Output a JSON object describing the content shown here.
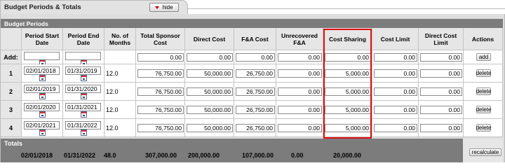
{
  "section": {
    "title": "Budget Periods & Totals",
    "hide_label": "hide"
  },
  "subsection": {
    "title": "Budget Periods"
  },
  "columns": [
    "",
    "Period Start Date",
    "Period End Date",
    "No. of Months",
    "Total Sponsor Cost",
    "Direct Cost",
    "F&A Cost",
    "Unrecovered F&A",
    "Cost Sharing",
    "Cost Limit",
    "Direct Cost Limit",
    "Actions"
  ],
  "add_row": {
    "label": "Add:",
    "start": "",
    "end": "",
    "total": "0.00",
    "direct": "0.00",
    "fa": "0.00",
    "unrecovered": "0.00",
    "cost_sharing": "0.00",
    "cost_limit": "0.00",
    "direct_limit": "0.00",
    "action": "add"
  },
  "rows": [
    {
      "num": "1",
      "start": "02/01/2018",
      "end": "01/31/2019",
      "months": "12.0",
      "total": "76,750.00",
      "direct": "50,000.00",
      "fa": "26,750.00",
      "unrecovered": "0.00",
      "cost_sharing": "5,000.00",
      "cost_limit": "0.00",
      "direct_limit": "0.00",
      "action": "delete"
    },
    {
      "num": "2",
      "start": "02/01/2019",
      "end": "01/31/2020",
      "months": "12.0",
      "total": "76,750.00",
      "direct": "50,000.00",
      "fa": "26,750.00",
      "unrecovered": "0.00",
      "cost_sharing": "5,000.00",
      "cost_limit": "0.00",
      "direct_limit": "0.00",
      "action": "delete"
    },
    {
      "num": "3",
      "start": "02/01/2020",
      "end": "01/31/2021",
      "months": "12.0",
      "total": "76,750.00",
      "direct": "50,000.00",
      "fa": "26,750.00",
      "unrecovered": "0.00",
      "cost_sharing": "5,000.00",
      "cost_limit": "0.00",
      "direct_limit": "0.00",
      "action": "delete"
    },
    {
      "num": "4",
      "start": "02/01/2021",
      "end": "01/31/2022",
      "months": "12.0",
      "total": "76,750.00",
      "direct": "50,000.00",
      "fa": "26,750.00",
      "unrecovered": "0.00",
      "cost_sharing": "5,000.00",
      "cost_limit": "0.00",
      "direct_limit": "0.00",
      "action": "delete"
    }
  ],
  "totals": {
    "title": "Totals",
    "start": "02/01/2018",
    "end": "01/31/2022",
    "months": "48.0",
    "total": "307,000.00",
    "direct": "200,000.00",
    "fa": "107,000.00",
    "unrecovered": "0.00",
    "cost_sharing": "20,000.00",
    "action": "recalculate"
  },
  "colors": {
    "highlight": "#e01010",
    "header_bar": "#7c7c7c",
    "delete_text": "#000000"
  }
}
